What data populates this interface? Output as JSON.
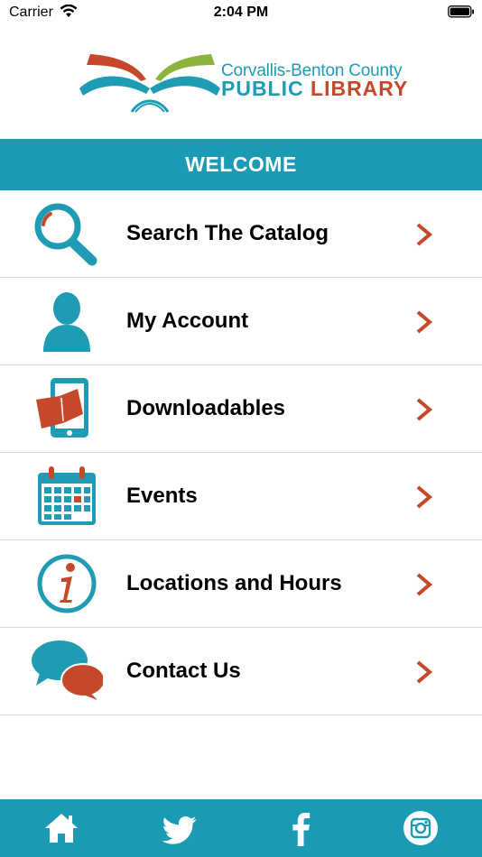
{
  "status_bar": {
    "carrier": "Carrier",
    "time": "2:04 PM",
    "wifi_icon": "wifi-icon",
    "battery_icon": "battery-full-icon"
  },
  "logo": {
    "line1": "Corvallis-Benton County",
    "line2_a": "PUBLIC",
    "line2_b": "LIBRARY",
    "colors": {
      "teal": "#1f9bb4",
      "orange": "#c5482a",
      "green": "#8cb43c"
    }
  },
  "welcome": {
    "title": "WELCOME"
  },
  "menu": {
    "items": [
      {
        "label": "Search The Catalog",
        "icon": "magnifier-icon"
      },
      {
        "label": "My Account",
        "icon": "person-icon"
      },
      {
        "label": "Downloadables",
        "icon": "tablet-book-icon"
      },
      {
        "label": "Events",
        "icon": "calendar-icon"
      },
      {
        "label": "Locations and Hours",
        "icon": "info-icon"
      },
      {
        "label": "Contact Us",
        "icon": "chat-bubbles-icon"
      }
    ],
    "chevron_color": "#c5482a"
  },
  "tab_bar": {
    "color": "#1b9bb3",
    "tabs": [
      {
        "icon": "home-icon"
      },
      {
        "icon": "twitter-icon"
      },
      {
        "icon": "facebook-icon"
      },
      {
        "icon": "instagram-icon"
      }
    ]
  }
}
